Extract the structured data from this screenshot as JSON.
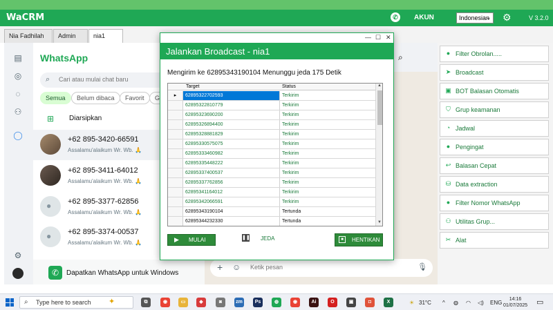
{
  "app": {
    "brand": "WaCRM",
    "akun": "AKUN",
    "language": "Indonesian",
    "version": "V 3.2.0"
  },
  "tabs": [
    "Nia Fadhilah",
    "Admin",
    "nia1"
  ],
  "whatsapp": {
    "title": "WhatsApp",
    "search_placeholder": "Cari atau mulai chat baru",
    "filters": [
      "Semua",
      "Belum dibaca",
      "Favorit",
      "G"
    ],
    "archived": "Diarsipkan",
    "chats": [
      {
        "name": "+62 895-3420-66591",
        "msg": "Assalamu'alaikum Wr. Wb. 🙏"
      },
      {
        "name": "+62 895-3411-64012",
        "msg": "Assalamu'alaikum Wr. Wb. 🙏"
      },
      {
        "name": "+62 895-3377-62856",
        "msg": "Assalamu'alaikum Wr. Wb. 🙏"
      },
      {
        "name": "+62 895-3374-00537",
        "msg": "Assalamu'alaikum Wr. Wb. 🙏"
      }
    ],
    "promo": "Dapatkan WhatsApp untuk Windows",
    "compose_placeholder": "Ketik pesan"
  },
  "menu": [
    {
      "label": "Filter Obrolan.....",
      "icon": "filter-icon"
    },
    {
      "label": "Broadcast",
      "icon": "send-icon"
    },
    {
      "label": "BOT Balasan Otomatis",
      "icon": "bot-icon"
    },
    {
      "label": "Grup keamanan",
      "icon": "shield-icon"
    },
    {
      "label": "Jadwal",
      "icon": "schedule-icon"
    },
    {
      "label": "Pengingat",
      "icon": "bell-icon"
    },
    {
      "label": "Balasan Cepat",
      "icon": "reply-icon"
    },
    {
      "label": "Data extraction",
      "icon": "database-icon"
    },
    {
      "label": "Filter Nomor WhatsApp",
      "icon": "filter-number-icon"
    },
    {
      "label": "Utilitas Grup...",
      "icon": "group-icon"
    },
    {
      "label": "Alat",
      "icon": "tools-icon"
    }
  ],
  "dialog": {
    "title": "Jalankan Broadcast - nia1",
    "status": "Mengirim ke 62895343190104  Menunggu jeda 175 Detik",
    "columns": [
      "Target",
      "Status"
    ],
    "rows": [
      {
        "target": "62895322702593",
        "status": "Terkirim"
      },
      {
        "target": "62895322810779",
        "status": "Terkirim"
      },
      {
        "target": "62895323690200",
        "status": "Terkirim"
      },
      {
        "target": "62895326894400",
        "status": "Terkirim"
      },
      {
        "target": "62895328881829",
        "status": "Terkirim"
      },
      {
        "target": "62895330575075",
        "status": "Terkirim"
      },
      {
        "target": "62895333460982",
        "status": "Terkirim"
      },
      {
        "target": "62895335448222",
        "status": "Terkirim"
      },
      {
        "target": "62895337400537",
        "status": "Terkirim"
      },
      {
        "target": "62895337762856",
        "status": "Terkirim"
      },
      {
        "target": "62895341164012",
        "status": "Terkirim"
      },
      {
        "target": "62895342066591",
        "status": "Terkirim"
      },
      {
        "target": "62895343190104",
        "status": "Tertunda"
      },
      {
        "target": "62895344232330",
        "status": "Tertunda"
      }
    ],
    "btn_start": "MULAI",
    "btn_pause": "JEDA",
    "btn_stop": "HENTIKAN"
  },
  "taskbar": {
    "search": "Type here to search",
    "temp": "31°C",
    "lang": "ENG",
    "time": "14:16",
    "date": "01/07/2025"
  }
}
